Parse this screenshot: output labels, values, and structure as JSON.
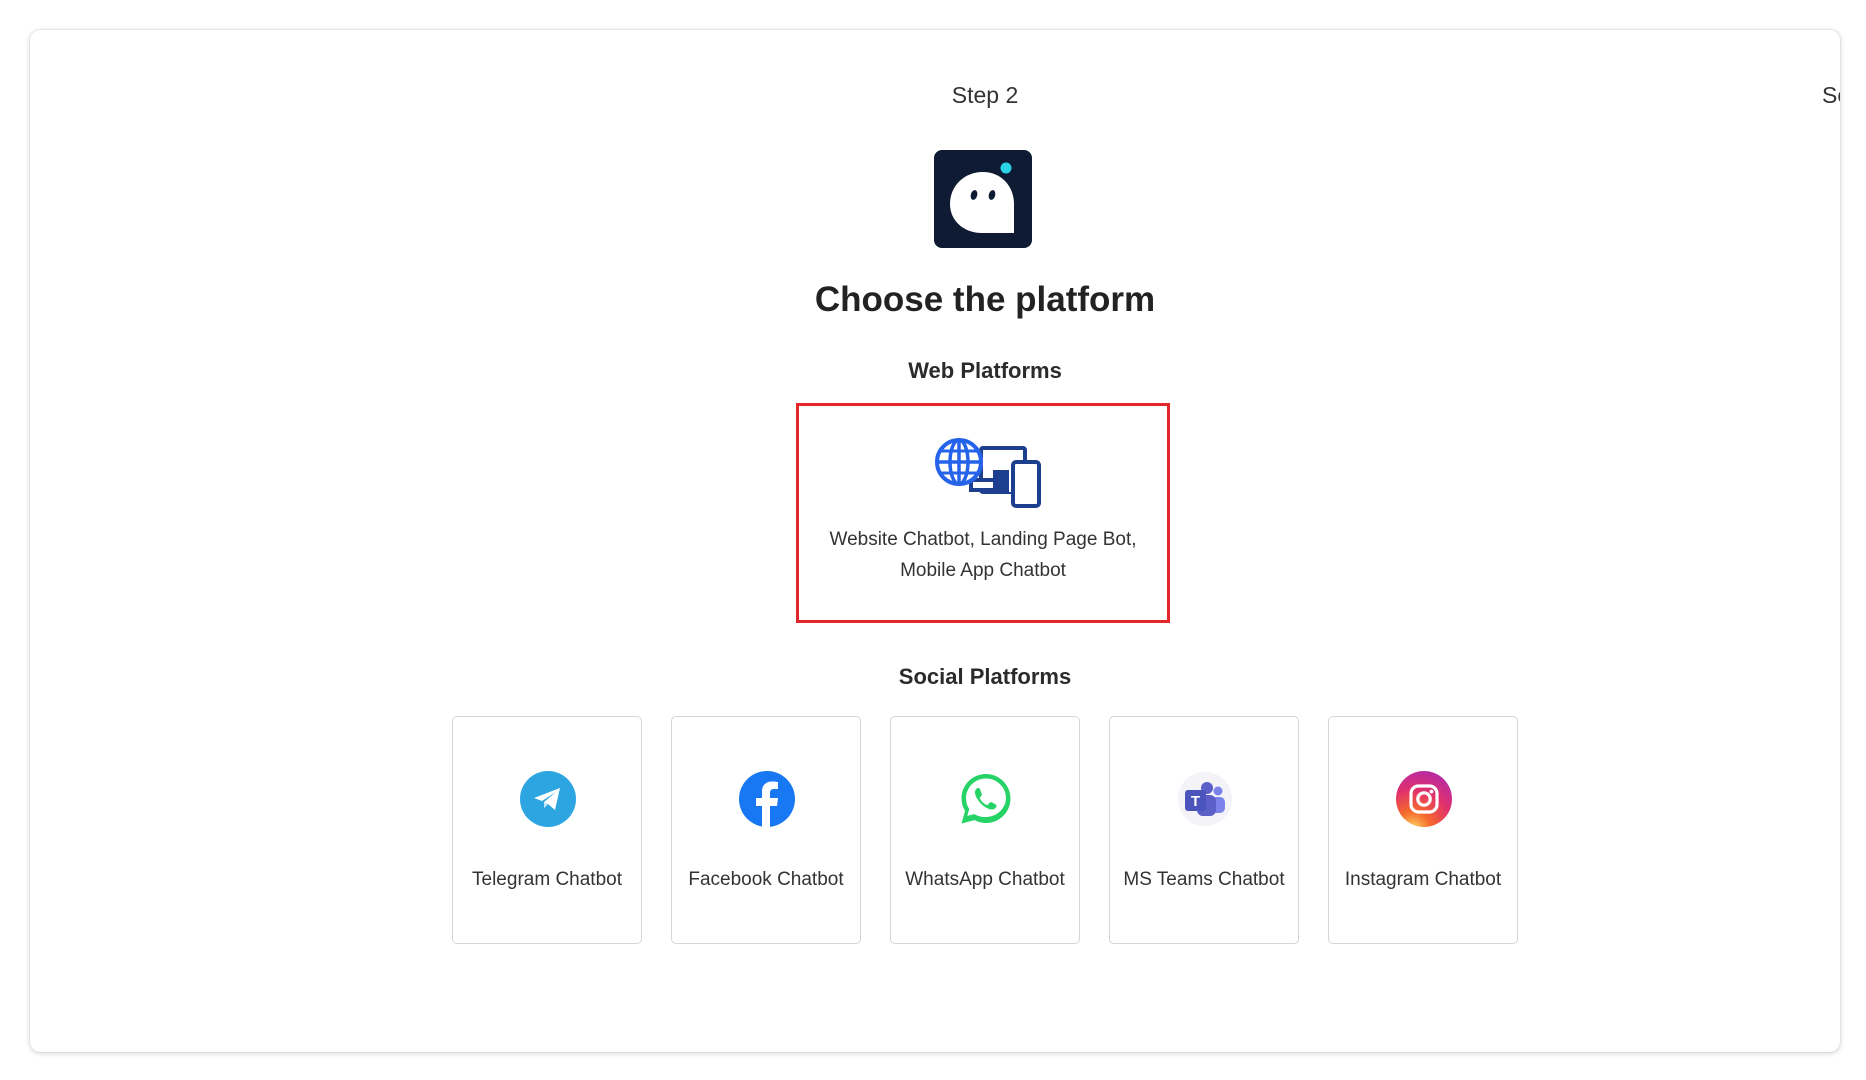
{
  "header": {
    "step_label": "Step 2",
    "next_step_partial": "Se"
  },
  "title": "Choose the platform",
  "web_section": {
    "heading": "Web Platforms",
    "card": {
      "line1": "Website Chatbot, Landing Page Bot,",
      "line2": "Mobile App Chatbot",
      "icon": "globe-devices-icon",
      "selected": true
    }
  },
  "social_section": {
    "heading": "Social Platforms",
    "cards": [
      {
        "label": "Telegram Chatbot",
        "icon": "telegram-icon",
        "color": "#2ca5e0"
      },
      {
        "label": "Facebook Chatbot",
        "icon": "facebook-icon",
        "color": "#1877f2"
      },
      {
        "label": "WhatsApp Chatbot",
        "icon": "whatsapp-icon",
        "color": "#25d366"
      },
      {
        "label": "MS Teams Chatbot",
        "icon": "ms-teams-icon",
        "color": "#5b5fc7"
      },
      {
        "label": "Instagram Chatbot",
        "icon": "instagram-icon",
        "color": "#e1306c"
      }
    ]
  },
  "colors": {
    "selection_border": "#e3262b",
    "logo_bg": "#0f1b33",
    "logo_accent": "#2ad4e6"
  }
}
